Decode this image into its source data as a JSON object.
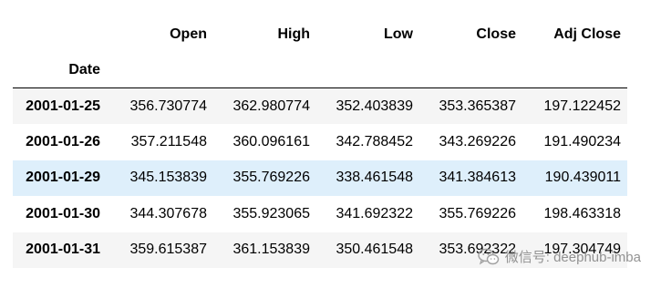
{
  "table": {
    "columns": [
      "Open",
      "High",
      "Low",
      "Close",
      "Adj Close"
    ],
    "index_name": "Date",
    "rows": [
      {
        "date": "2001-01-25",
        "values": [
          "356.730774",
          "362.980774",
          "352.403839",
          "353.365387",
          "197.122452"
        ]
      },
      {
        "date": "2001-01-26",
        "values": [
          "357.211548",
          "360.096161",
          "342.788452",
          "343.269226",
          "191.490234"
        ]
      },
      {
        "date": "2001-01-29",
        "values": [
          "345.153839",
          "355.769226",
          "338.461548",
          "341.384613",
          "190.439011"
        ]
      },
      {
        "date": "2001-01-30",
        "values": [
          "344.307678",
          "355.923065",
          "341.692322",
          "355.769226",
          "198.463318"
        ]
      },
      {
        "date": "2001-01-31",
        "values": [
          "359.615387",
          "361.153839",
          "350.461548",
          "353.692322",
          "197.304749"
        ]
      }
    ],
    "highlighted_row": 2
  },
  "watermark": {
    "text": "微信号: deephub-imba",
    "icon": "wechat-icon"
  },
  "colors": {
    "row_striped": "#f5f5f5",
    "row_hover": "#deeffb",
    "watermark": "#8a8a8a"
  }
}
